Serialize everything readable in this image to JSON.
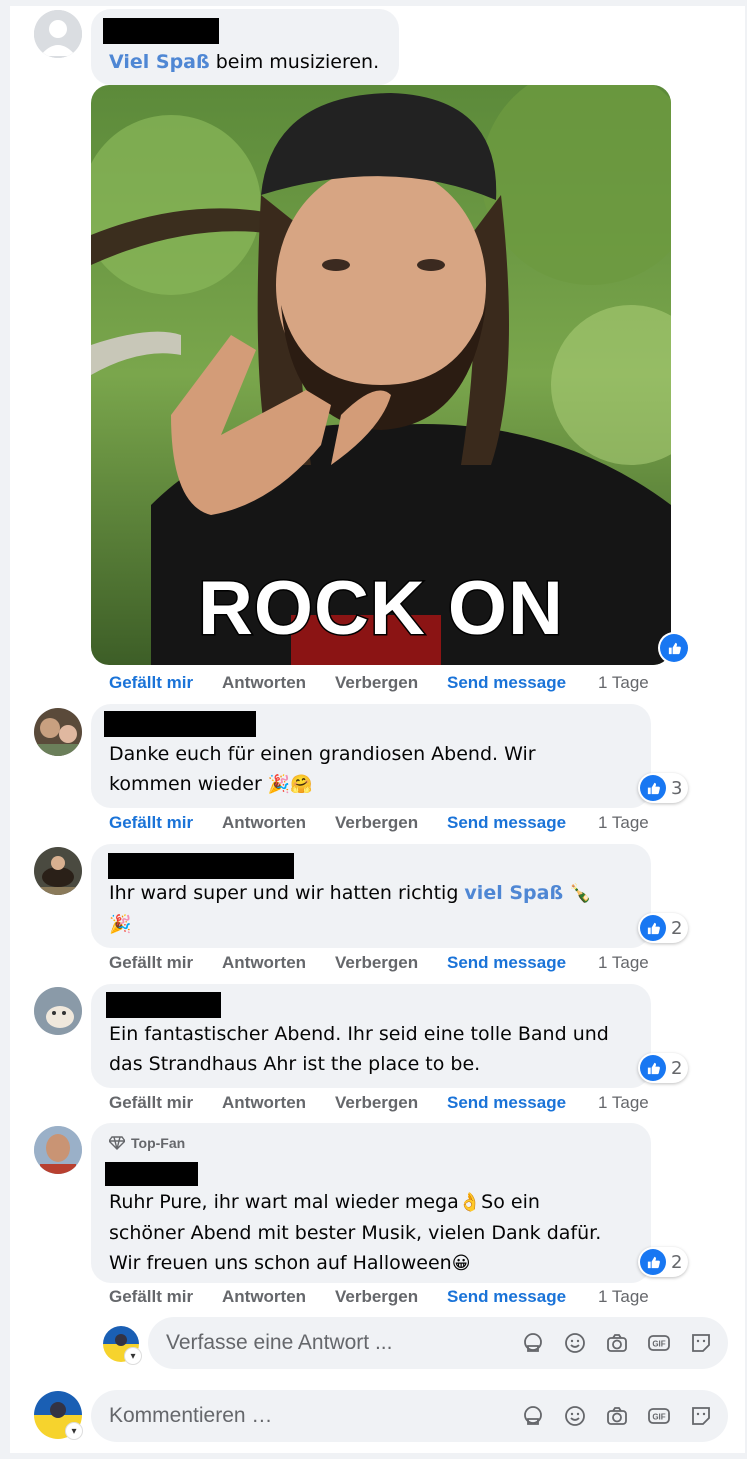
{
  "comment0": {
    "highlight": "Viel Spaß",
    "text": " beim musizieren.",
    "gif_caption": "ROCK ON",
    "actions": {
      "like": "Gefällt mir",
      "reply": "Antworten",
      "hide": "Verbergen",
      "send": "Send message",
      "time": "1 Tage"
    }
  },
  "comment1": {
    "line1": "Danke euch für einen grandiosen Abend. Wir",
    "line2": "kommen wieder ",
    "emoji": "🎉🤗",
    "reactions": "3",
    "actions": {
      "like": "Gefällt mir",
      "reply": "Antworten",
      "hide": "Verbergen",
      "send": "Send message",
      "time": "1 Tage"
    }
  },
  "comment2": {
    "text": "Ihr ward super und wir hatten richtig ",
    "highlight": "viel Spaß",
    "emoji1": "🍾",
    "emoji2": "🎉",
    "reactions": "2",
    "actions": {
      "like": "Gefällt mir",
      "reply": "Antworten",
      "hide": "Verbergen",
      "send": "Send message",
      "time": "1 Tage"
    }
  },
  "comment3": {
    "line1": "Ein fantastischer Abend. Ihr seid eine tolle Band und",
    "line2": "das Strandhaus Ahr ist the place to be.",
    "reactions": "2",
    "actions": {
      "like": "Gefällt mir",
      "reply": "Antworten",
      "hide": "Verbergen",
      "send": "Send message",
      "time": "1 Tage"
    }
  },
  "comment4": {
    "badge": "Top-Fan",
    "line1": "Ruhr Pure, ihr wart mal wieder mega",
    "emoji1": "👌",
    "line1b": "So ein",
    "line2": "schöner Abend mit bester Musik, vielen Dank dafür.",
    "line3": "Wir freuen uns schon auf Halloween",
    "emoji2": "😀",
    "reactions": "2",
    "actions": {
      "like": "Gefällt mir",
      "reply": "Antworten",
      "hide": "Verbergen",
      "send": "Send message",
      "time": "1 Tage"
    }
  },
  "reply_box": {
    "placeholder": "Verfasse eine Antwort ..."
  },
  "comment_box": {
    "placeholder": "Kommentieren …"
  },
  "tool_icons": [
    "avatar-sticker-icon",
    "emoji-icon",
    "camera-icon",
    "gif-icon",
    "sticker-icon"
  ],
  "colors": {
    "link": "#1a73d8",
    "highlight": "#4f87d4",
    "like": "#1877f2",
    "bubble": "#f0f2f5"
  }
}
